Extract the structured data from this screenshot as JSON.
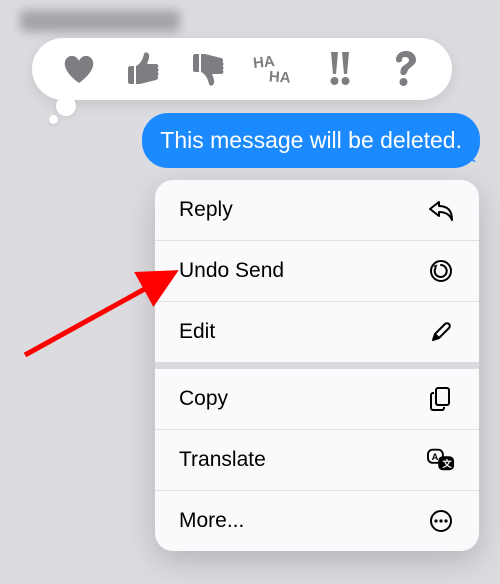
{
  "message": {
    "text": "This message will be deleted."
  },
  "tapback": {
    "reactions": [
      {
        "name": "heart"
      },
      {
        "name": "thumbs-up"
      },
      {
        "name": "thumbs-down"
      },
      {
        "name": "haha"
      },
      {
        "name": "double-exclaim"
      },
      {
        "name": "question"
      }
    ]
  },
  "menu": {
    "groups": [
      [
        {
          "label": "Reply",
          "icon": "reply"
        },
        {
          "label": "Undo Send",
          "icon": "undo"
        },
        {
          "label": "Edit",
          "icon": "pencil"
        }
      ],
      [
        {
          "label": "Copy",
          "icon": "copy"
        },
        {
          "label": "Translate",
          "icon": "translate"
        },
        {
          "label": "More...",
          "icon": "more"
        }
      ]
    ]
  },
  "annotation": {
    "highlighted_item": "Undo Send"
  }
}
